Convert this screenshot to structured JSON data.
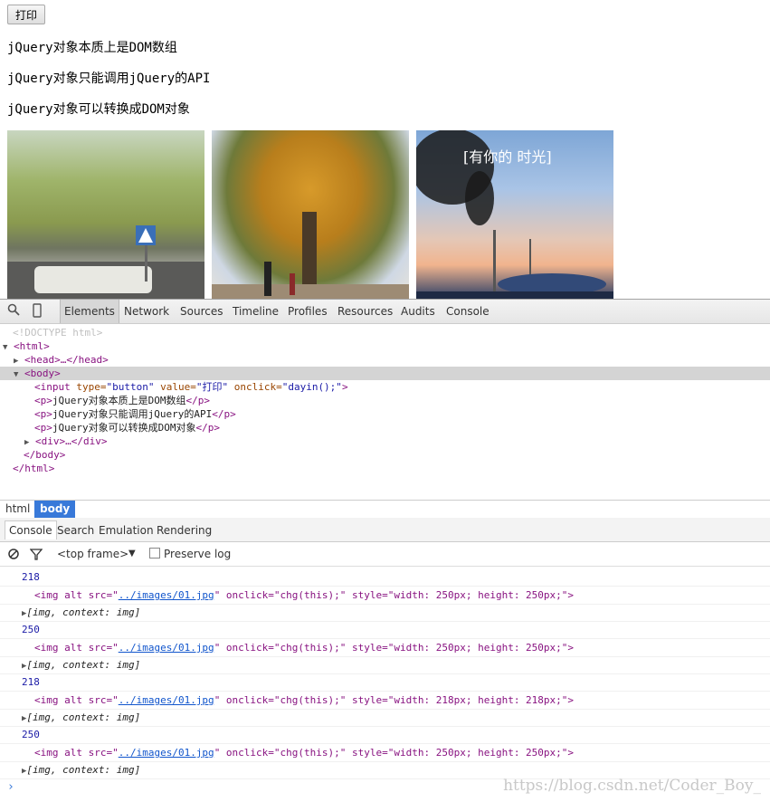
{
  "page": {
    "button_label": "打印",
    "paragraphs": [
      "jQuery对象本质上是DOM数组",
      "jQuery对象只能调用jQuery的API",
      "jQuery对象可以转换成DOM对象"
    ],
    "image3_caption": "[有你的    时光]"
  },
  "devtools": {
    "tabs": [
      "Elements",
      "Network",
      "Sources",
      "Timeline",
      "Profiles",
      "Resources",
      "Audits",
      "Console"
    ],
    "active_tab": "Elements",
    "dom": {
      "doctype": "<!DOCTYPE html>",
      "html_open": "<html>",
      "head": "<head>…</head>",
      "body_open": "<body>",
      "input_line": {
        "tag": "<input",
        "a1": " type=",
        "v1": "\"button\"",
        "a2": " value=",
        "v2": "\"打印\"",
        "a3": " onclick=",
        "v3": "\"dayin();\"",
        "end": ">"
      },
      "p1": {
        "open": "<p>",
        "text": "jQuery对象本质上是DOM数组",
        "close": "</p>"
      },
      "p2": {
        "open": "<p>",
        "text": "jQuery对象只能调用jQuery的API",
        "close": "</p>"
      },
      "p3": {
        "open": "<p>",
        "text": "jQuery对象可以转换成DOM对象",
        "close": "</p>"
      },
      "div": "<div>…</div>",
      "body_close": "</body>",
      "html_close": "</html>"
    },
    "breadcrumbs": [
      "html",
      "body"
    ],
    "drawer_tabs": [
      "Console",
      "Search",
      "Emulation",
      "Rendering"
    ],
    "console_toolbar": {
      "frame": "<top frame>",
      "preserve_log": "Preserve log"
    },
    "console_entries": [
      {
        "number": "218",
        "img": {
          "pre": "<img alt src=\"",
          "link": "../images/01.jpg",
          "post": "\" onclick=\"chg(this);\" style=\"width: 250px; height: 250px;\">"
        },
        "obj": "[img, context: img]"
      },
      {
        "number": "250",
        "img": {
          "pre": "<img alt src=\"",
          "link": "../images/01.jpg",
          "post": "\" onclick=\"chg(this);\" style=\"width: 250px; height: 250px;\">"
        },
        "obj": "[img, context: img]"
      },
      {
        "number": "218",
        "img": {
          "pre": "<img alt src=\"",
          "link": "../images/01.jpg",
          "post": "\" onclick=\"chg(this);\" style=\"width: 218px; height: 218px;\">"
        },
        "obj": "[img, context: img]"
      },
      {
        "number": "250",
        "img": {
          "pre": "<img alt src=\"",
          "link": "../images/01.jpg",
          "post": "\" onclick=\"chg(this);\" style=\"width: 250px; height: 250px;\">"
        },
        "obj": "[img, context: img]"
      }
    ],
    "prompt": "›"
  },
  "watermark": "https://blog.csdn.net/Coder_Boy_"
}
